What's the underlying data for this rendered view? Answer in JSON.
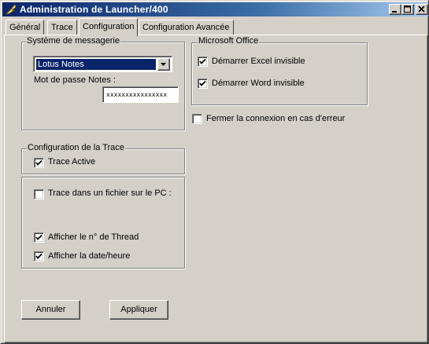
{
  "window": {
    "title": "Administration de Launcher/400",
    "icon": "launcher-feather-icon",
    "controls": [
      "minimize-icon",
      "maximize-icon",
      "close-icon"
    ]
  },
  "tabs": [
    {
      "label": "Général",
      "active": false
    },
    {
      "label": "Trace",
      "active": false
    },
    {
      "label": "Configuration",
      "active": true
    },
    {
      "label": "Configuration Avancée",
      "active": false
    }
  ],
  "messaging": {
    "group_label": "Système de messagerie",
    "system_value": "Lotus Notes",
    "password_label": "Mot de passe Notes :",
    "password_value": "xxxxxxxxxxxxxxxx"
  },
  "office": {
    "group_label": "Microsoft Office",
    "excel_label": "Démarrer Excel invisible",
    "excel_checked": true,
    "word_label": "Démarrer Word invisible",
    "word_checked": true
  },
  "close_on_error": {
    "label": "Fermer la connexion en cas d'erreur",
    "checked": false
  },
  "trace": {
    "group_label": "Configuration de la Trace",
    "active_label": "Trace Active",
    "active_checked": true,
    "file_label": "Trace dans un fichier sur le PC :",
    "file_checked": false,
    "thread_label": "Afficher le n° de Thread",
    "thread_checked": true,
    "datetime_label": "Afficher la date/heure",
    "datetime_checked": true
  },
  "buttons": {
    "cancel_label": "Annuler",
    "apply_label": "Appliquer"
  }
}
